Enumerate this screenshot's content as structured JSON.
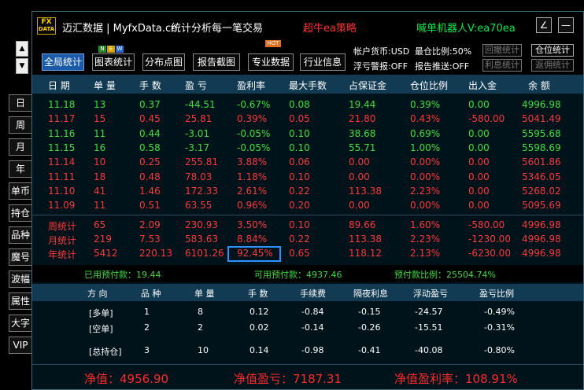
{
  "colors": {
    "red": "#ff3838",
    "green": "#3ce03c",
    "header_bg": "#123b53",
    "accent_blue": "#1a5aa8"
  },
  "left_scroll": {
    "up": "▲",
    "down": "▼"
  },
  "side_tabs": [
    "日",
    "周",
    "月",
    "年",
    "单币",
    "持仓",
    "品种",
    "魔号",
    "波幅",
    "属性",
    "大字",
    "VIP"
  ],
  "title": {
    "logo_top": "FX",
    "logo_bottom": "DATA",
    "app_name": "迈汇数据 | MyfxData.cn",
    "slogan": "统计分析每一笔交易",
    "strategy": "超牛ea策略",
    "robot": "喊单机器人V:ea70ea",
    "edit_icon": "∠",
    "minimize_icon": "—"
  },
  "toolbar": {
    "buttons": [
      "全局统计",
      "图表统计",
      "分布点图",
      "报告截图",
      "专业数据",
      "行业信息"
    ],
    "new_badge": [
      "N",
      "E",
      "W"
    ],
    "hot_badge": "HOT",
    "account_currency": "帐户货币:USD",
    "margin_ratio": "最仓比例:50%",
    "float_alert": "浮亏警报:OFF",
    "report_push": "报告推送:OFF",
    "btn_withdraw": "回撤统计",
    "btn_position": "仓位统计",
    "btn_interest": "利息统计",
    "btn_rebate": "返佣统计"
  },
  "table": {
    "headers": [
      "日 期",
      "单 量",
      "手 数",
      "盈 亏",
      "盈利率",
      "最大手数",
      "占保证金",
      "仓位比例",
      "出入金",
      "余 额"
    ],
    "daily": [
      {
        "date": "11.18",
        "orders": "13",
        "lots": "0.37",
        "pnl": "-44.51",
        "rate": "-0.67%",
        "max": "0.08",
        "margin": "19.44",
        "pos": "0.39%",
        "flow": "0.00",
        "bal": "4996.98",
        "color": "green"
      },
      {
        "date": "11.17",
        "orders": "15",
        "lots": "0.45",
        "pnl": "25.81",
        "rate": "0.39%",
        "max": "0.05",
        "margin": "21.80",
        "pos": "0.43%",
        "flow": "-580.00",
        "bal": "5041.49",
        "color": "red"
      },
      {
        "date": "11.16",
        "orders": "11",
        "lots": "0.44",
        "pnl": "-3.01",
        "rate": "-0.05%",
        "max": "0.10",
        "margin": "38.68",
        "pos": "0.69%",
        "flow": "0.00",
        "bal": "5595.68",
        "color": "green"
      },
      {
        "date": "11.15",
        "orders": "16",
        "lots": "0.58",
        "pnl": "-3.17",
        "rate": "-0.05%",
        "max": "0.10",
        "margin": "55.71",
        "pos": "1.00%",
        "flow": "0.00",
        "bal": "5598.69",
        "color": "green"
      },
      {
        "date": "11.14",
        "orders": "10",
        "lots": "0.25",
        "pnl": "255.81",
        "rate": "3.88%",
        "max": "0.06",
        "margin": "0.00",
        "pos": "0.00%",
        "flow": "0.00",
        "bal": "5601.86",
        "color": "red"
      },
      {
        "date": "11.11",
        "orders": "18",
        "lots": "0.48",
        "pnl": "78.03",
        "rate": "1.18%",
        "max": "0.10",
        "margin": "0.00",
        "pos": "0.00%",
        "flow": "0.00",
        "bal": "5346.05",
        "color": "red"
      },
      {
        "date": "11.10",
        "orders": "41",
        "lots": "1.46",
        "pnl": "172.33",
        "rate": "2.61%",
        "max": "0.22",
        "margin": "113.38",
        "pos": "2.23%",
        "flow": "0.00",
        "bal": "5268.02",
        "color": "red"
      },
      {
        "date": "11.09",
        "orders": "11",
        "lots": "0.51",
        "pnl": "63.55",
        "rate": "0.96%",
        "max": "0.20",
        "margin": "0.00",
        "pos": "0.00%",
        "flow": "0.00",
        "bal": "5095.69",
        "color": "red"
      }
    ],
    "stats": [
      {
        "date": "周统计",
        "orders": "65",
        "lots": "2.09",
        "pnl": "230.93",
        "rate": "3.50%",
        "max": "0.10",
        "margin": "89.66",
        "pos": "1.60%",
        "flow": "-580.00",
        "bal": "4996.98",
        "color": "red"
      },
      {
        "date": "月统计",
        "orders": "219",
        "lots": "7.53",
        "pnl": "583.63",
        "rate": "8.84%",
        "max": "0.22",
        "margin": "113.38",
        "pos": "2.23%",
        "flow": "-1230.00",
        "bal": "4996.98",
        "color": "red"
      },
      {
        "date": "年统计",
        "orders": "5412",
        "lots": "220.13",
        "pnl": "6101.26",
        "rate": "92.45%",
        "max": "0.65",
        "margin": "118.12",
        "pos": "2.13%",
        "flow": "-6230.00",
        "bal": "4996.98",
        "color": "red"
      }
    ]
  },
  "summary": {
    "used": "已用预付款：19.44",
    "available": "可用预付款：4937.46",
    "ratio": "预付款比例：25504.74%"
  },
  "positions": {
    "headers": [
      "方 向",
      "品 种",
      "单 量",
      "手 数",
      "手续费",
      "隔夜利息",
      "浮动盈亏",
      "盈亏比例"
    ],
    "rows": [
      {
        "dir": "[多单]",
        "sym": "1",
        "orders": "8",
        "lots": "0.12",
        "fee": "-0.84",
        "swap": "-0.15",
        "float": "-24.57",
        "ratio": "-0.49%"
      },
      {
        "dir": "[空单]",
        "sym": "2",
        "orders": "2",
        "lots": "0.02",
        "fee": "-0.14",
        "swap": "-0.26",
        "float": "-15.51",
        "ratio": "-0.31%"
      }
    ],
    "total": {
      "dir": "[总持仓]",
      "sym": "3",
      "orders": "10",
      "lots": "0.14",
      "fee": "-0.98",
      "swap": "-0.41",
      "float": "-40.08",
      "ratio": "-0.80%"
    }
  },
  "footer": {
    "equity": "净值：4956.90",
    "equity_pnl": "净值盈亏：7187.31",
    "equity_rate": "净值盈利率：108.91%"
  }
}
